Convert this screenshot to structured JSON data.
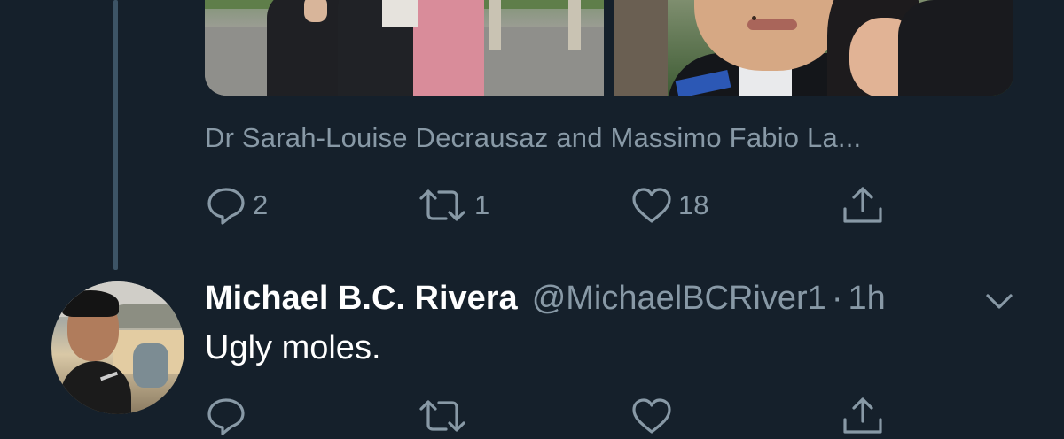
{
  "previous_tweet": {
    "tagged_people": "Dr Sarah-Louise Decrausaz and Massimo Fabio La...",
    "actions": {
      "reply_count": "2",
      "retweet_count": "1",
      "like_count": "18"
    }
  },
  "reply_tweet": {
    "display_name": "Michael B.C. Rivera",
    "handle": "@MichaelBCRiver1",
    "separator": "·",
    "time": "1h",
    "text": "Ugly moles.",
    "actions": {
      "reply_count": "",
      "retweet_count": "",
      "like_count": ""
    }
  },
  "icons": {
    "reply": "speech-bubble-icon",
    "retweet": "retweet-arrows-icon",
    "like": "heart-icon",
    "share": "share-upload-icon",
    "more": "chevron-down-icon"
  },
  "colors": {
    "background": "#15202b",
    "secondary_text": "#8899a6",
    "primary_text": "#ffffff",
    "thread_line": "#3d5466"
  }
}
